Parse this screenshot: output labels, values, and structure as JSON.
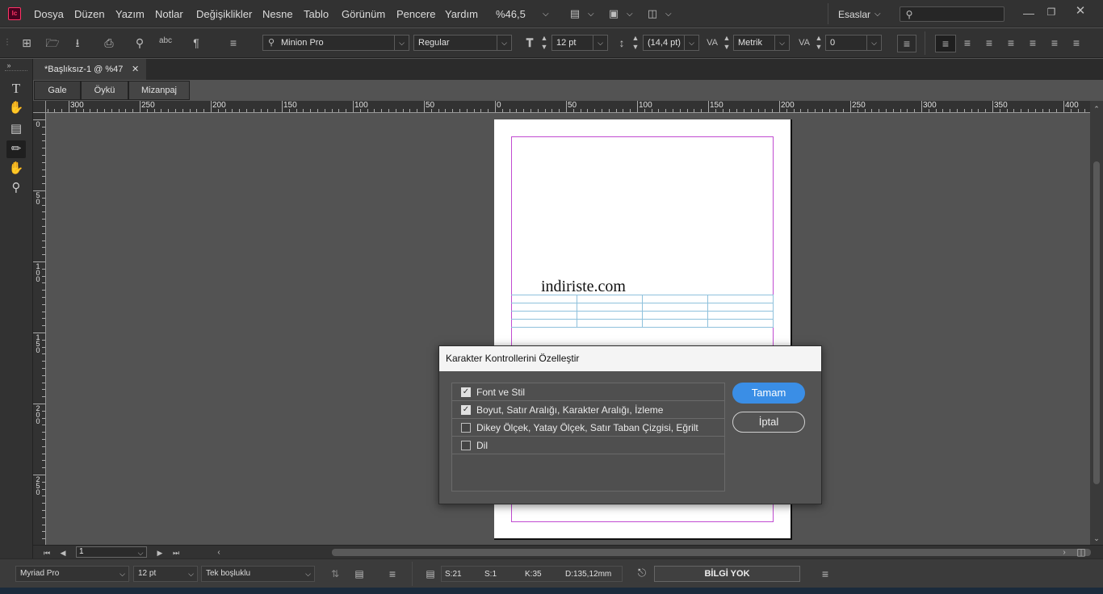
{
  "app": {
    "logo": "Ic"
  },
  "menu": {
    "items": [
      "Dosya",
      "Düzen",
      "Yazım",
      "Notlar",
      "Değişiklikler",
      "Nesne",
      "Tablo",
      "Görünüm",
      "Pencere",
      "Yardım"
    ],
    "zoom": "%46,5",
    "workspace": "Esaslar",
    "search_placeholder": ""
  },
  "control": {
    "font_family": "Minion Pro",
    "font_style": "Regular",
    "font_size": "12 pt",
    "leading": "(14,4 pt)",
    "kerning": "Metrik",
    "tracking": "0"
  },
  "document": {
    "tab_title": "*Başlıksız-1 @ %47",
    "panel_tabs": [
      "Gale",
      "Öykü",
      "Mizanpaj"
    ],
    "page_text": "indiriste.com"
  },
  "rulers": {
    "h_labels": [
      "300",
      "250",
      "200",
      "150",
      "100",
      "50",
      "0",
      "50",
      "100",
      "150",
      "200",
      "250",
      "300",
      "350",
      "400"
    ],
    "v_labels": [
      "0",
      "50",
      "100",
      "150",
      "200",
      "250"
    ]
  },
  "nav": {
    "page": "1"
  },
  "status": {
    "font": "Myriad Pro",
    "size": "12 pt",
    "spacing": "Tek boşluklu",
    "line": "S:21",
    "word": "S:1",
    "chars": "K:35",
    "depth": "D:135,12mm",
    "info": "BİLGİ YOK"
  },
  "dialog": {
    "title": "Karakter Kontrollerini Özelleştir",
    "options": [
      {
        "label": "Font ve Stil",
        "checked": true
      },
      {
        "label": "Boyut, Satır Aralığı, Karakter Aralığı, İzleme",
        "checked": true
      },
      {
        "label": "Dikey Ölçek, Yatay Ölçek, Satır Taban Çizgisi, Eğrilt",
        "checked": false
      },
      {
        "label": "Dil",
        "checked": false
      }
    ],
    "ok_label": "Tamam",
    "cancel_label": "İptal"
  },
  "colors": {
    "accent": "#3a8ee6",
    "margin_guide": "#c14bd1",
    "table_line": "#8fc1dc"
  }
}
